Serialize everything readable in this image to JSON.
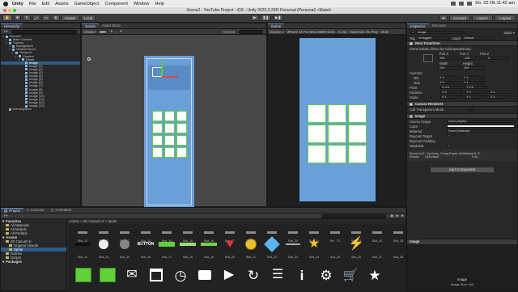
{
  "menubar": {
    "app": "Unity",
    "items": [
      "File",
      "Edit",
      "Assets",
      "GameObject",
      "Component",
      "Window",
      "Help"
    ],
    "clock": "Do. 22 Ok 11:42 am"
  },
  "window": {
    "title": "Scene2 - YouTube Project - iOS - Unity 2020.3.29f1 Personal (Personal) <Metal>"
  },
  "toolbar": {
    "pivot": "Center",
    "space": "Local",
    "account": "Account",
    "layers": "Layers",
    "layout": "Layout"
  },
  "hierarchy": {
    "tab": "Hierarchy",
    "rows": [
      {
        "label": "Scene2*",
        "depth": 0
      },
      {
        "label": "Main Camera",
        "depth": 1
      },
      {
        "label": "Canvas",
        "depth": 1
      },
      {
        "label": "Background",
        "depth": 2
      },
      {
        "label": "Vertical Scroll",
        "depth": 2
      },
      {
        "label": "Viewport",
        "depth": 3
      },
      {
        "label": "Content",
        "depth": 4
      },
      {
        "label": "Panel",
        "depth": 5
      },
      {
        "label": "Image",
        "depth": 6,
        "selected": true
      },
      {
        "label": "Image (1)",
        "depth": 6
      },
      {
        "label": "Image (2)",
        "depth": 6
      },
      {
        "label": "Image (3)",
        "depth": 6
      },
      {
        "label": "Image (4)",
        "depth": 6
      },
      {
        "label": "Image (5)",
        "depth": 6
      },
      {
        "label": "Image (6)",
        "depth": 6
      },
      {
        "label": "Image (7)",
        "depth": 6
      },
      {
        "label": "Image (8)",
        "depth": 6
      },
      {
        "label": "Image (9)",
        "depth": 6
      },
      {
        "label": "Image (10)",
        "depth": 6
      },
      {
        "label": "Image (11)",
        "depth": 6
      },
      {
        "label": "Image (12)",
        "depth": 6
      },
      {
        "label": "Image (13)",
        "depth": 6
      },
      {
        "label": "EventSystem",
        "depth": 1
      }
    ]
  },
  "scene": {
    "tab": "Scene",
    "tab2": "Asset Store",
    "shading": "Shaded",
    "mode": "2D",
    "gizmos": "Gizmos"
  },
  "game": {
    "tab": "Game",
    "display": "Display 1",
    "device": "iPhone 11 Pro Max 2688×1242",
    "scale": "0.24x",
    "maximize": "Maximize On Play",
    "mute": "Mute"
  },
  "inspector": {
    "tab": "Inspector",
    "tab2": "Services",
    "object": "Image",
    "tag_label": "Tag",
    "tag": "Untagged",
    "layer_label": "Layer",
    "layer": "Default",
    "rect_transform": "Rect Transform",
    "driven_note": "Some values driven by GridLayoutGroup.",
    "pos_headers": [
      "Pos X",
      "Pos Y",
      "Pos Z"
    ],
    "pos_values": [
      "165",
      "-165",
      "0"
    ],
    "size_headers": [
      "Width",
      "Height"
    ],
    "size_values": [
      "200",
      "200"
    ],
    "anchors": "Anchors",
    "min_label": "Min",
    "min_values": [
      "X 0",
      "Y 1"
    ],
    "max_label": "Max",
    "max_values": [
      "X 0",
      "Y 1"
    ],
    "pivot_label": "Pivot",
    "pivot_values": [
      "X 0.5",
      "Y 0.5"
    ],
    "rotation_label": "Rotation",
    "rotation_values": [
      "X 0",
      "Y 0",
      "Z 0"
    ],
    "scale_label": "Scale",
    "scale_values": [
      "X 1",
      "Y 1",
      "Z 1"
    ],
    "canvas_renderer": "Canvas Renderer",
    "cull_label": "Cull Transparent Mesh",
    "image_section": "Image",
    "source_image_label": "Source Image",
    "source_image": "None (Sprite)",
    "color_label": "Color",
    "material_label": "Material",
    "material": "None (Material)",
    "raycast_target": "Raycast Target",
    "raycast_padding": "Raycast Padding",
    "maskable": "Maskable",
    "shader_note": "Stencil Id:1, Op:Keep, Comp:Equal, WriteMask:0, R...",
    "shader": "Shader",
    "shader_value": "UI/Default",
    "edit": "Edit...",
    "add_component": "Add Component",
    "preview_title": "Image",
    "preview_caption": "Image",
    "preview_size": "Image Size: 0x0"
  },
  "project": {
    "tabs": [
      "Project",
      "Console",
      "Animation"
    ],
    "breadcrumb": "Assets > 2D Casual UI > Sprite",
    "tree": [
      {
        "label": "Favorites",
        "head": true,
        "depth": 0
      },
      {
        "label": "All Materials",
        "depth": 1
      },
      {
        "label": "All Models",
        "depth": 1
      },
      {
        "label": "All Prefabs",
        "depth": 1
      },
      {
        "label": "Assets",
        "head": true,
        "depth": 0
      },
      {
        "label": "2D Casual UI",
        "depth": 1
      },
      {
        "label": "Original Artwork",
        "depth": 2
      },
      {
        "label": "Sprite",
        "depth": 2,
        "selected": true
      },
      {
        "label": "Scenes",
        "depth": 1
      },
      {
        "label": "Scripts",
        "depth": 1
      },
      {
        "label": "Packages",
        "head": true,
        "depth": 0
      }
    ],
    "top_row_labels": [
      "Slot_10",
      "Slot_11",
      "Slot_12",
      "Slot_13",
      "Slot_14",
      "Slot_15",
      "Slot_16",
      "Slot_17",
      "Slot_18",
      "Slot_19",
      "Slot_20",
      "Slot_21",
      "Slot_22",
      "Slot_23",
      "Slot_24",
      "Slot_25"
    ],
    "mid_row_labels": [
      "Slot_13",
      "Slot_14",
      "Slot_15",
      "Slot_16",
      "Slot_17",
      "Slot_18",
      "Slot_19",
      "Slot_20",
      "Slot_21",
      "Slot_22",
      "Slot_23",
      "Slot_24",
      "Slot_25",
      "Slot_26",
      "Slot_27",
      "Slot_28"
    ],
    "button_text": "BUTTON",
    "bottom_icons": [
      "green-square-icon",
      "green-square-icon",
      "mail-icon",
      "calendar-icon",
      "clock-icon",
      "video-icon",
      "play-icon",
      "refresh-icon",
      "list-icon",
      "info-icon",
      "gear-icon",
      "cart-icon",
      "star-icon"
    ]
  },
  "colors": {
    "accent": "#4a8fe7",
    "canvas_blue": "#6a9fd8",
    "slot_green": "#60d13a",
    "selection": "#2c5d87"
  }
}
